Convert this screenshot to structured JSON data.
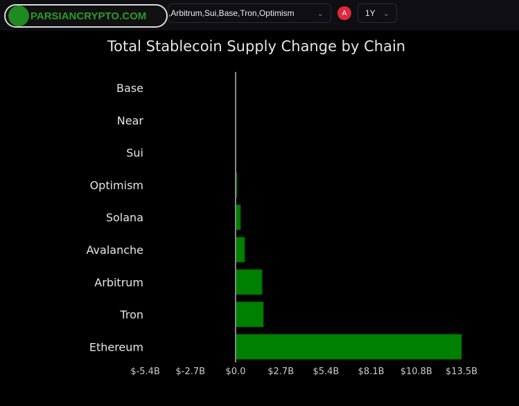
{
  "header": {
    "logo_text": "PARSIANCRYPTO.COM",
    "chains_select": ",Arbitrum,Sui,Base,Tron,Optimism",
    "badge": "A",
    "period_select": "1Y"
  },
  "chart_data": {
    "type": "bar",
    "orientation": "horizontal",
    "title": "Total Stablecoin Supply Change by Chain",
    "categories": [
      "Base",
      "Near",
      "Sui",
      "Optimism",
      "Solana",
      "Avalanche",
      "Arbitrum",
      "Tron",
      "Ethereum"
    ],
    "values": [
      0,
      0,
      0,
      0.08,
      0.29,
      0.54,
      1.58,
      1.66,
      13.5
    ],
    "unit": "B USD",
    "xticks": [
      "$-5.4B",
      "$-2.7B",
      "$0.0",
      "$2.7B",
      "$5.4B",
      "$8.1B",
      "$10.8B",
      "$13.5B"
    ],
    "xtick_values": [
      -5.4,
      -2.7,
      0,
      2.7,
      5.4,
      8.1,
      10.8,
      13.5
    ],
    "bar_color": "#008000",
    "grid": false,
    "legend": "none"
  }
}
